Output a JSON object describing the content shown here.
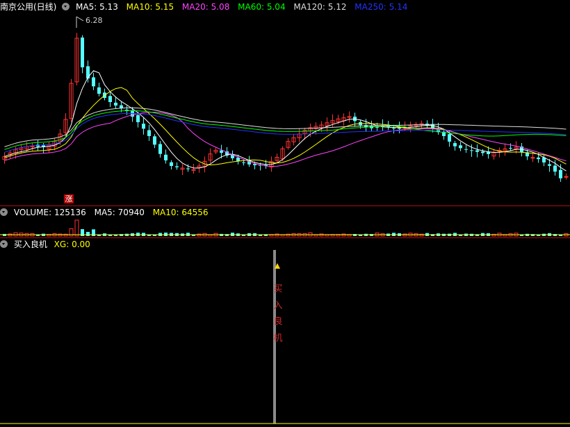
{
  "price_panel": {
    "stock_name": "南京公用(日线)",
    "indicators": [
      {
        "label": "MA5:",
        "value": "5.13",
        "color": "#ffffff"
      },
      {
        "label": "MA10:",
        "value": "5.15",
        "color": "#ffff00"
      },
      {
        "label": "MA20:",
        "value": "5.08",
        "color": "#ff44ff"
      },
      {
        "label": "MA60:",
        "value": "5.04",
        "color": "#00ff00"
      },
      {
        "label": "MA120:",
        "value": "5.12",
        "color": "#dddddd"
      },
      {
        "label": "MA250:",
        "value": "5.14",
        "color": "#2233ff"
      }
    ],
    "peak_price": "6.28",
    "limit_up_marker": "涨"
  },
  "volume_panel": {
    "indicators": [
      {
        "label": "VOLUME:",
        "value": "125136",
        "color": "#ffffff"
      },
      {
        "label": "MA5:",
        "value": "70940",
        "color": "#ffffff"
      },
      {
        "label": "MA10:",
        "value": "64556",
        "color": "#ffff00"
      }
    ]
  },
  "signal_panel": {
    "indicator_name": "买入良机",
    "indicators": [
      {
        "label": "XG:",
        "value": "0.00",
        "color": "#ffff00"
      }
    ],
    "signal_text": [
      "买",
      "入",
      "良",
      "机"
    ]
  },
  "colors": {
    "background": "#000000",
    "up_candle": "#ff3232",
    "down_candle": "#54ffff",
    "separator": "#b01010"
  }
}
